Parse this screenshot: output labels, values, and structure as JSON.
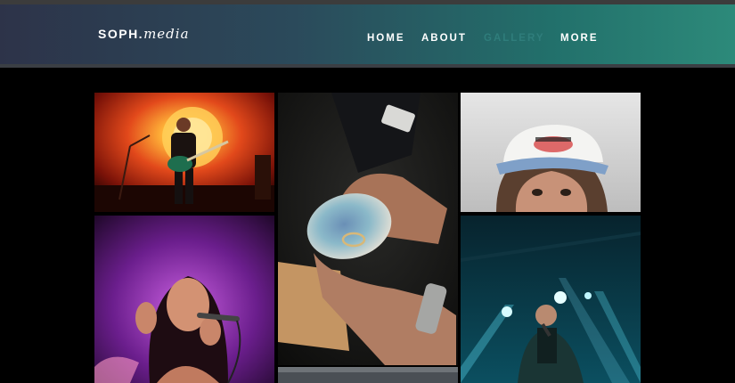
{
  "logo": {
    "part1": "SOPH.",
    "part2": "media"
  },
  "nav": {
    "home": "HOME",
    "about": "ABOUT",
    "gallery": "GALLERY",
    "more": "MORE"
  },
  "colors": {
    "header_start": "#2d3349",
    "header_end": "#2d8a7a",
    "active_nav": "#2f7d7b",
    "background": "#000000"
  },
  "gallery": {
    "photos": [
      {
        "subject": "guitarist-on-stage-sunset"
      },
      {
        "subject": "hands-holding-abalone-shell-with-rings"
      },
      {
        "subject": "woman-in-white-cap"
      },
      {
        "subject": "female-singer-purple-light"
      },
      {
        "subject": "male-singer-blue-stage-lights"
      },
      {
        "subject": "partial-photo-bottom"
      }
    ]
  }
}
